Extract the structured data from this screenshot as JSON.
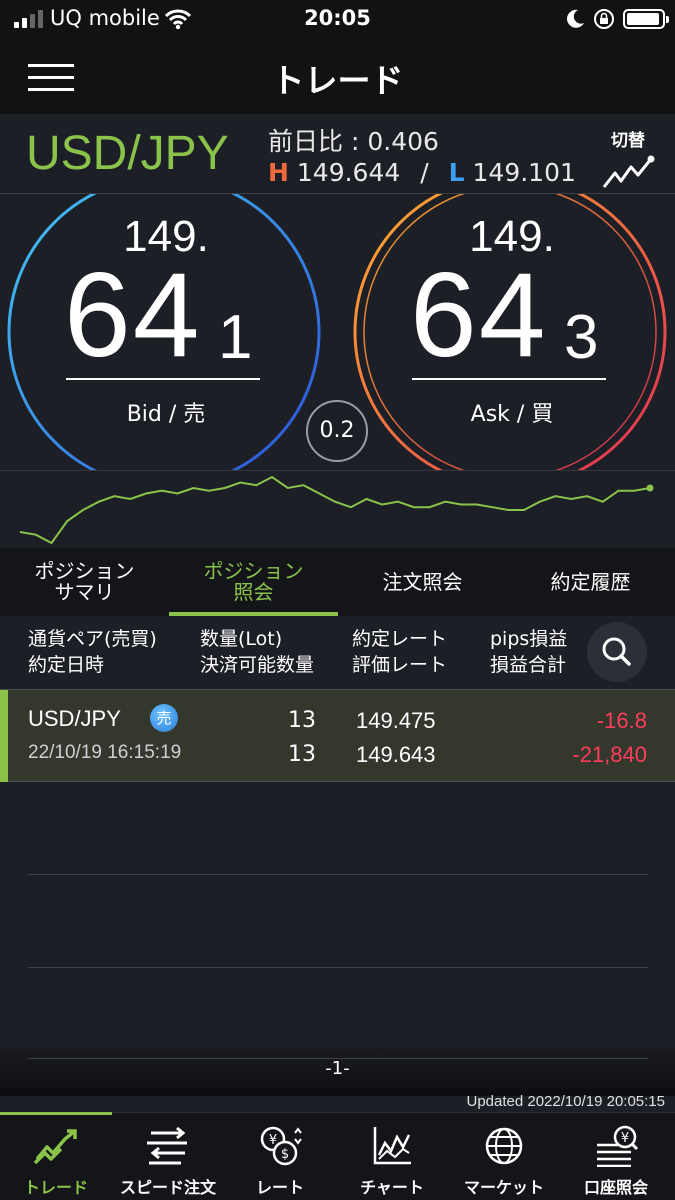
{
  "status_bar": {
    "carrier": "UQ mobile",
    "time": "20:05"
  },
  "nav": {
    "title": "トレード"
  },
  "pair": {
    "name": "USD/JPY",
    "prev_diff_label": "前日比",
    "prev_diff_value": "0.406",
    "high_label": "H",
    "high_value": "149.644",
    "separator": "/",
    "low_label": "L",
    "low_value": "149.101",
    "switch_label": "切替"
  },
  "bid": {
    "big": "149.",
    "pips": "64",
    "frac": "1",
    "label": "Bid / 売"
  },
  "ask": {
    "big": "149.",
    "pips": "64",
    "frac": "3",
    "label": "Ask / 買"
  },
  "spread": "0.2",
  "colors": {
    "accent": "#8bc34a",
    "negative": "#ff3d5a",
    "bid_ring_start": "#3ec0f5",
    "bid_ring_end": "#2f5fe0",
    "ask_ring_start": "#ff9a2e",
    "ask_ring_end": "#e8334a"
  },
  "chart_data": {
    "type": "line",
    "values": [
      149.44,
      149.43,
      149.4,
      149.48,
      149.52,
      149.55,
      149.57,
      149.56,
      149.58,
      149.59,
      149.58,
      149.6,
      149.59,
      149.6,
      149.62,
      149.61,
      149.64,
      149.6,
      149.61,
      149.58,
      149.55,
      149.53,
      149.56,
      149.54,
      149.55,
      149.53,
      149.53,
      149.55,
      149.54,
      149.54,
      149.53,
      149.52,
      149.52,
      149.55,
      149.57,
      149.56,
      149.57,
      149.55,
      149.59,
      149.59,
      149.6
    ]
  },
  "tabs": [
    {
      "label": "ポジション\nサマリ",
      "active": false
    },
    {
      "label": "ポジション\n照会",
      "active": true
    },
    {
      "label": "注文照会",
      "active": false
    },
    {
      "label": "約定履歴",
      "active": false
    }
  ],
  "table_header": {
    "col1": "通貨ペア(売買)\n約定日時",
    "col2": "数量(Lot)\n決済可能数量",
    "col3": "約定レート\n評価レート",
    "col4": "pips損益\n損益合計"
  },
  "positions": [
    {
      "pair": "USD/JPY",
      "side": "売",
      "datetime": "22/10/19 16:15:19",
      "qty": "13",
      "available_qty": "13",
      "exec_rate": "149.475",
      "eval_rate": "149.643",
      "pips": "-16.8",
      "pl": "-21,840"
    }
  ],
  "page_number": "-1-",
  "updated": "Updated  2022/10/19 20:05:15",
  "bottom_nav": [
    {
      "label": "トレード",
      "icon": "trade-chart-icon",
      "active": true
    },
    {
      "label": "スピード注文",
      "icon": "speed-order-icon",
      "active": false
    },
    {
      "label": "レート",
      "icon": "rate-yen-dollar-icon",
      "active": false
    },
    {
      "label": "チャート",
      "icon": "chart-icon",
      "active": false
    },
    {
      "label": "マーケット",
      "icon": "globe-icon",
      "active": false
    },
    {
      "label": "口座照会",
      "icon": "account-yen-icon",
      "active": false
    }
  ]
}
